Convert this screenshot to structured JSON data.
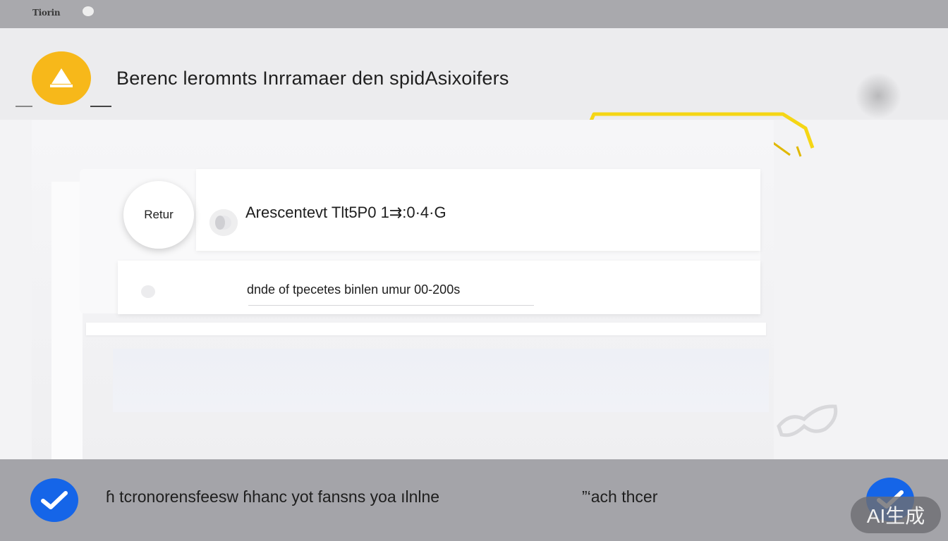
{
  "topbar": {
    "app_name": "Tiorin"
  },
  "header": {
    "title": "Berenc leromnts Inrramaer den  spidAsixoifers"
  },
  "card": {
    "return_label": "Retur",
    "row1_text": "Arescentevt Tlt5P0 1⇉:0·4·G",
    "row2_text": "dnde of tpecetes binlen umur 00-200s"
  },
  "footer": {
    "text_left": "ɦ tcronorensfeesw ɦhanc yot fansns yoa ılnlne",
    "text_right": "”‘ach thcer"
  },
  "watermark": "AI生成",
  "colors": {
    "accent_yellow": "#f7b81a",
    "check_blue": "#1565e8"
  }
}
